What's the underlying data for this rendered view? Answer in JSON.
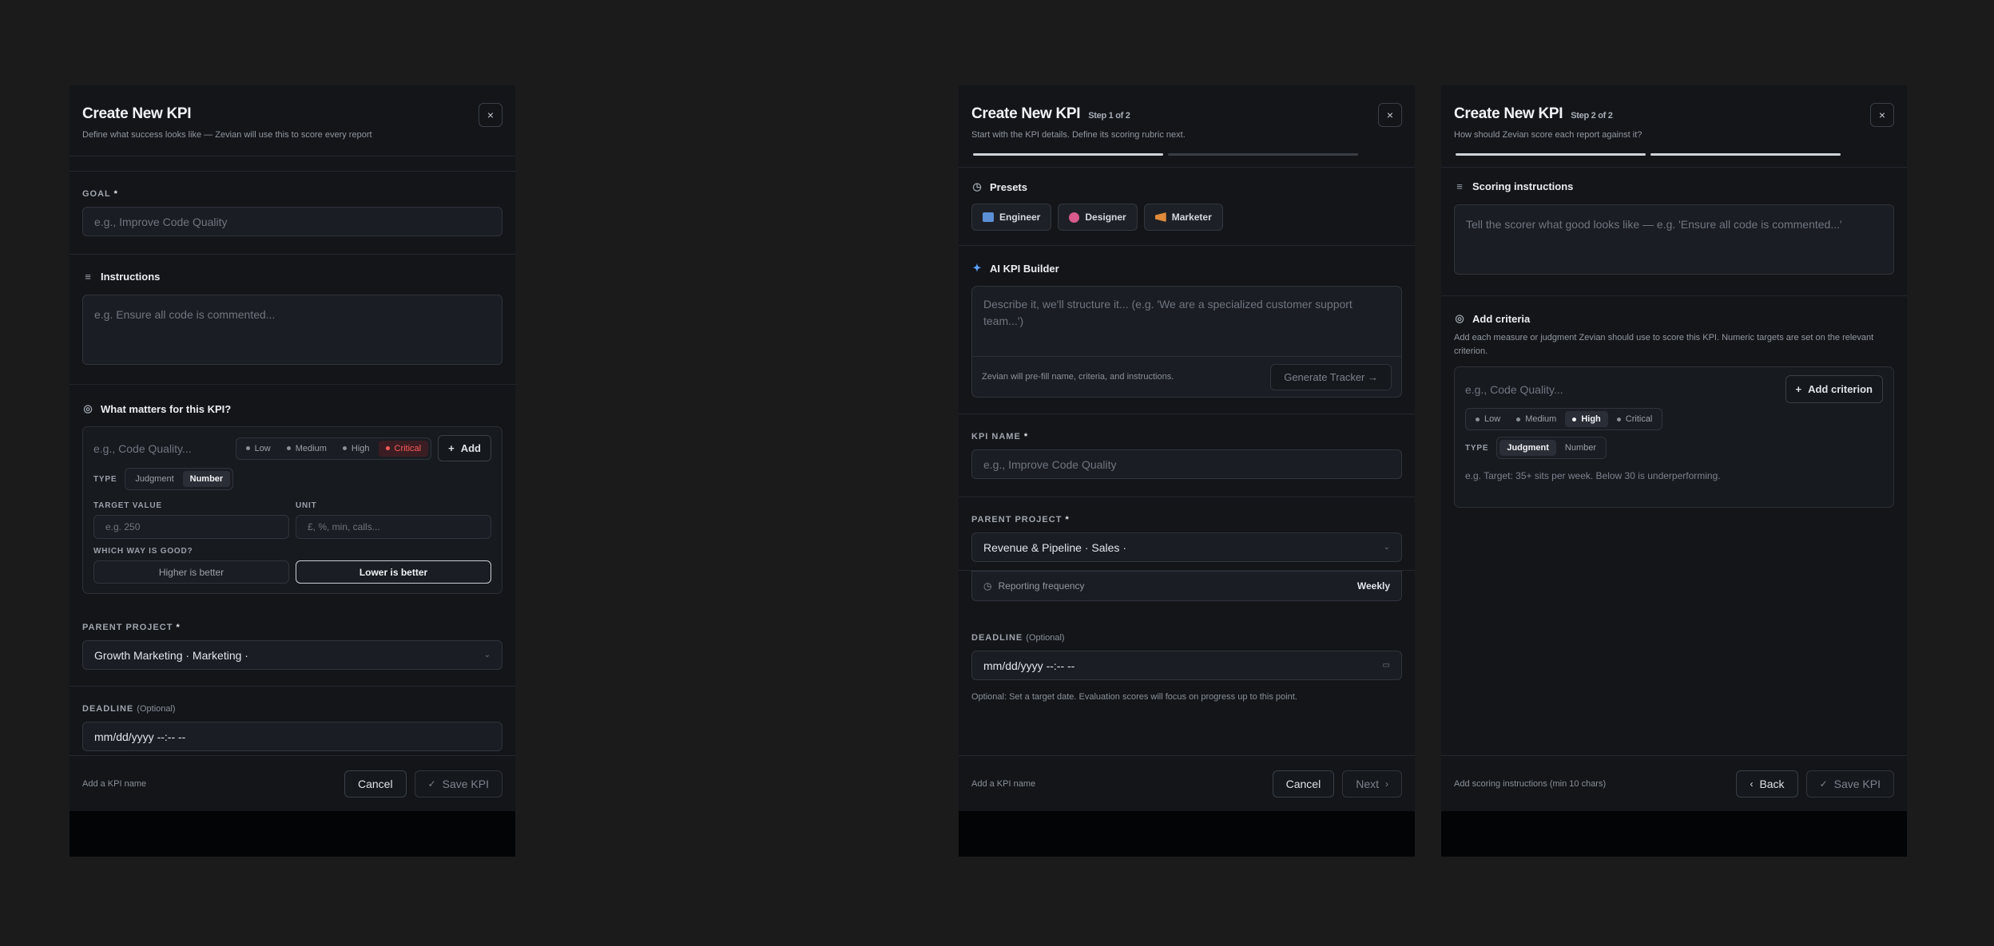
{
  "left": {
    "title": "Create New KPI",
    "subtitle": "Define what success looks like — Zevian will use this to score every report",
    "close": "×",
    "goal_label": "GOAL",
    "goal_placeholder": "e.g., Improve Code Quality",
    "instructions_title": "Instructions",
    "instructions_placeholder": "e.g. Ensure all code is commented...",
    "matters_title": "What matters for this KPI?",
    "criterion_placeholder": "e.g., Code Quality...",
    "priorities": [
      "Low",
      "Medium",
      "High",
      "Critical"
    ],
    "add_label": "Add",
    "type_label": "TYPE",
    "type_options": [
      "Judgment",
      "Number"
    ],
    "target_label": "TARGET VALUE",
    "target_placeholder": "e.g. 250",
    "unit_label": "UNIT",
    "unit_placeholder": "£, %, min, calls...",
    "direction_label": "WHICH WAY IS GOOD?",
    "direction_options": [
      "Higher is better",
      "Lower is better"
    ],
    "parent_label": "PARENT PROJECT",
    "parent_value": "Growth Marketing · Marketing ·",
    "deadline_label": "DEADLINE",
    "deadline_optional": "(Optional)",
    "deadline_value": "mm/dd/yyyy --:-- --",
    "footer_hint": "Add a KPI name",
    "cancel": "Cancel",
    "save": "Save KPI"
  },
  "middle": {
    "title": "Create New KPI",
    "step": "Step 1 of 2",
    "subtitle": "Start with the KPI details. Define its scoring rubric next.",
    "close": "×",
    "presets_title": "Presets",
    "presets": [
      {
        "label": "Engineer",
        "color": "#5b8fd6"
      },
      {
        "label": "Designer",
        "color": "#d85a8f"
      },
      {
        "label": "Marketer",
        "color": "#e08a3a"
      }
    ],
    "ai_title": "AI KPI Builder",
    "ai_placeholder": "Describe it, we'll structure it... (e.g. 'We are a specialized customer support team...')",
    "ai_hint": "Zevian will pre-fill name, criteria, and instructions.",
    "generate": "Generate Tracker →",
    "name_label": "KPI NAME",
    "name_placeholder": "e.g., Improve Code Quality",
    "parent_label": "PARENT PROJECT",
    "parent_value": "Revenue & Pipeline · Sales ·",
    "freq_label": "Reporting frequency",
    "freq_value": "Weekly",
    "deadline_label": "DEADLINE",
    "deadline_optional": "(Optional)",
    "deadline_value": "mm/dd/yyyy --:-- --",
    "deadline_hint": "Optional: Set a target date. Evaluation scores will focus on progress up to this point.",
    "footer_hint": "Add a KPI name",
    "cancel": "Cancel",
    "next": "Next"
  },
  "right": {
    "title": "Create New KPI",
    "step": "Step 2 of 2",
    "subtitle": "How should Zevian score each report against it?",
    "close": "×",
    "scoring_title": "Scoring instructions",
    "scoring_placeholder": "Tell the scorer what good looks like — e.g. 'Ensure all code is commented...'",
    "criteria_title": "Add criteria",
    "criteria_desc": "Add each measure or judgment Zevian should use to score this KPI. Numeric targets are set on the relevant criterion.",
    "criterion_placeholder": "e.g., Code Quality...",
    "add_criterion": "Add criterion",
    "priorities": [
      "Low",
      "Medium",
      "High",
      "Critical"
    ],
    "type_label": "TYPE",
    "type_options": [
      "Judgment",
      "Number"
    ],
    "example": "e.g. Target: 35+ sits per week. Below 30 is underperforming.",
    "footer_hint": "Add scoring instructions (min 10 chars)",
    "back": "Back",
    "save": "Save KPI"
  }
}
